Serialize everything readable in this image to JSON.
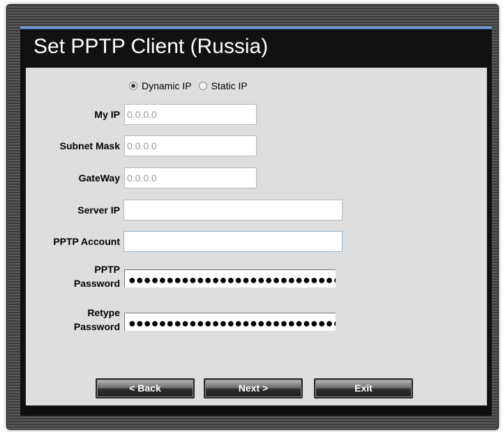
{
  "dialog": {
    "title": "Set PPTP Client (Russia)"
  },
  "ip_mode": {
    "options": [
      {
        "label": "Dynamic IP",
        "selected": true
      },
      {
        "label": "Static IP",
        "selected": false
      }
    ]
  },
  "fields": {
    "my_ip": {
      "label": "My IP",
      "value": "0.0.0.0"
    },
    "subnet_mask": {
      "label": "Subnet Mask",
      "value": "0.0.0.0"
    },
    "gateway": {
      "label": "GateWay",
      "value": "0.0.0.0"
    },
    "server_ip": {
      "label": "Server IP",
      "value": ""
    },
    "pptp_account": {
      "label": "PPTP Account",
      "value": ""
    },
    "pptp_password": {
      "label_line1": "PPTP",
      "label_line2": "Password",
      "value": "●●●●●●●●●●●●●●●●●●●●●●●●●●●●"
    },
    "retype_password": {
      "label_line1": "Retype",
      "label_line2": "Password",
      "value": "●●●●●●●●●●●●●●●●●●●●●●●●●●●●"
    }
  },
  "buttons": {
    "back": "< Back",
    "next": "Next >",
    "exit": "Exit"
  },
  "colors": {
    "title_text": "#ffffff",
    "accent_line": "#3e6fba",
    "form_bg": "#dedede"
  }
}
